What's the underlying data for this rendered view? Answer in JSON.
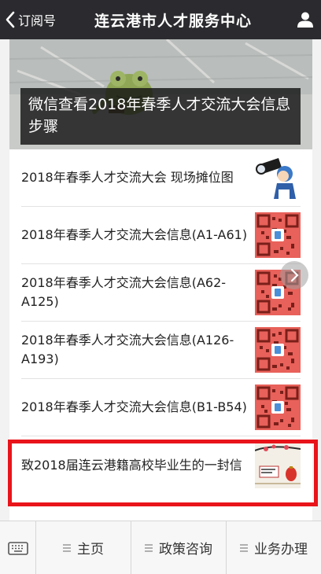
{
  "header": {
    "back_label": "订阅号",
    "title": "连云港市人才服务中心"
  },
  "hero": {
    "caption": "微信查看2018年春季人才交流大会信息步骤"
  },
  "articles": [
    {
      "title": "2018年春季人才交流大会 现场摊位图",
      "thumb": "telescope-cartoon"
    },
    {
      "title": "2018年春季人才交流大会信息(A1-A61)",
      "thumb": "qr-code"
    },
    {
      "title": "2018年春季人才交流大会信息(A62-A125)",
      "thumb": "qr-code"
    },
    {
      "title": "2018年春季人才交流大会信息(A126-A193)",
      "thumb": "qr-code"
    },
    {
      "title": "2018年春季人才交流大会信息(B1-B54)",
      "thumb": "qr-code"
    },
    {
      "title": "致2018届连云港籍高校毕业生的一封信",
      "thumb": "letter-illustration"
    }
  ],
  "bottom_menu": {
    "items": [
      {
        "label": "主页"
      },
      {
        "label": "政策咨询"
      },
      {
        "label": "业务办理"
      }
    ]
  },
  "colors": {
    "header_bg": "#2b2b2f",
    "highlight": "#e8141a",
    "qr_bg": "#e8615a"
  },
  "icons": {
    "back": "chevron-left-icon",
    "profile": "person-icon",
    "keyboard": "keyboard-icon",
    "menu": "hamburger-icon",
    "scroll": "chevron-right-icon"
  }
}
